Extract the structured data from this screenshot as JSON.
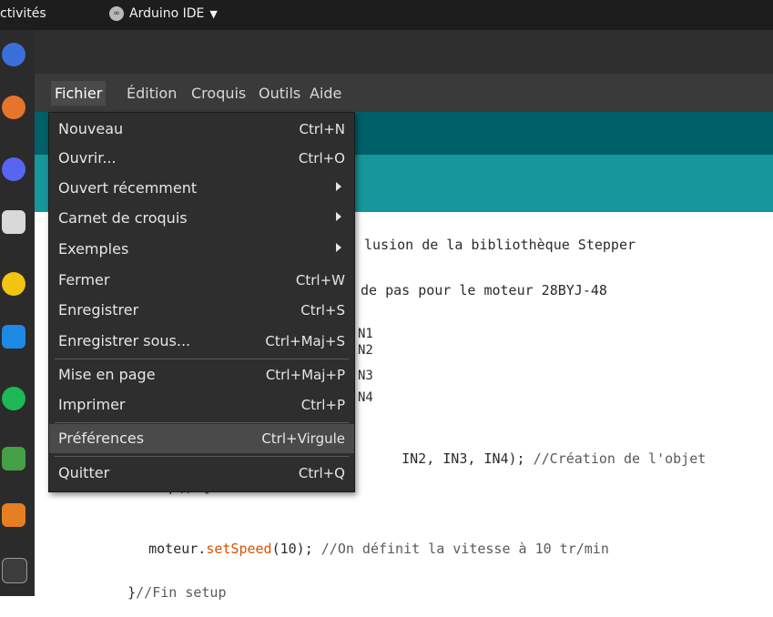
{
  "topbar": {
    "activities": "ctivités",
    "app_name": "Arduino IDE",
    "app_icon": "arduino-icon"
  },
  "dock": {
    "icons": [
      "chromium-icon",
      "firefox-icon",
      "discord-icon",
      "files-icon",
      "disk-icon",
      "vscode-icon",
      "spotify-icon",
      "chart-icon",
      "document-icon",
      "terminal-icon"
    ]
  },
  "menubar": {
    "items": [
      "Fichier",
      "Édition",
      "Croquis",
      "Outils",
      "Aide"
    ]
  },
  "menu": {
    "items": [
      {
        "label": "Nouveau",
        "accel": "Ctrl+N"
      },
      {
        "label": "Ouvrir...",
        "accel": "Ctrl+O"
      },
      {
        "label": "Ouvert récemment",
        "submenu": true
      },
      {
        "label": "Carnet de croquis",
        "submenu": true
      },
      {
        "label": "Exemples",
        "submenu": true
      },
      {
        "label": "Fermer",
        "accel": "Ctrl+W"
      },
      {
        "label": "Enregistrer",
        "accel": "Ctrl+S"
      },
      {
        "label": "Enregistrer sous...",
        "accel": "Ctrl+Maj+S"
      },
      {
        "label": "Mise en page",
        "accel": "Ctrl+Maj+P"
      },
      {
        "label": "Imprimer",
        "accel": "Ctrl+P"
      },
      {
        "label": "Préférences",
        "accel": "Ctrl+Virgule",
        "highlighted": true
      },
      {
        "label": "Quitter",
        "accel": "Ctrl+Q"
      }
    ]
  },
  "code": {
    "line1": "lusion de la bibliothèque Stepper",
    "line2": "de pas pour le moteur 28BYJ-48",
    "pin1": "N1",
    "pin2": "N2",
    "pin3": "N3",
    "pin4": "N4",
    "line_obj_code": "IN2, IN3, IN4);",
    "line_obj_comment": "//Création de l'objet",
    "line_setup": "void setup() {",
    "line_speed_pre": "moteur.",
    "line_speed_fn": "setSpeed",
    "line_speed_post": "(10);",
    "line_speed_comment": "//On définit la vitesse à 10 tr/min",
    "line_end_brace": "}",
    "line_end_comment": "//Fin setup"
  }
}
